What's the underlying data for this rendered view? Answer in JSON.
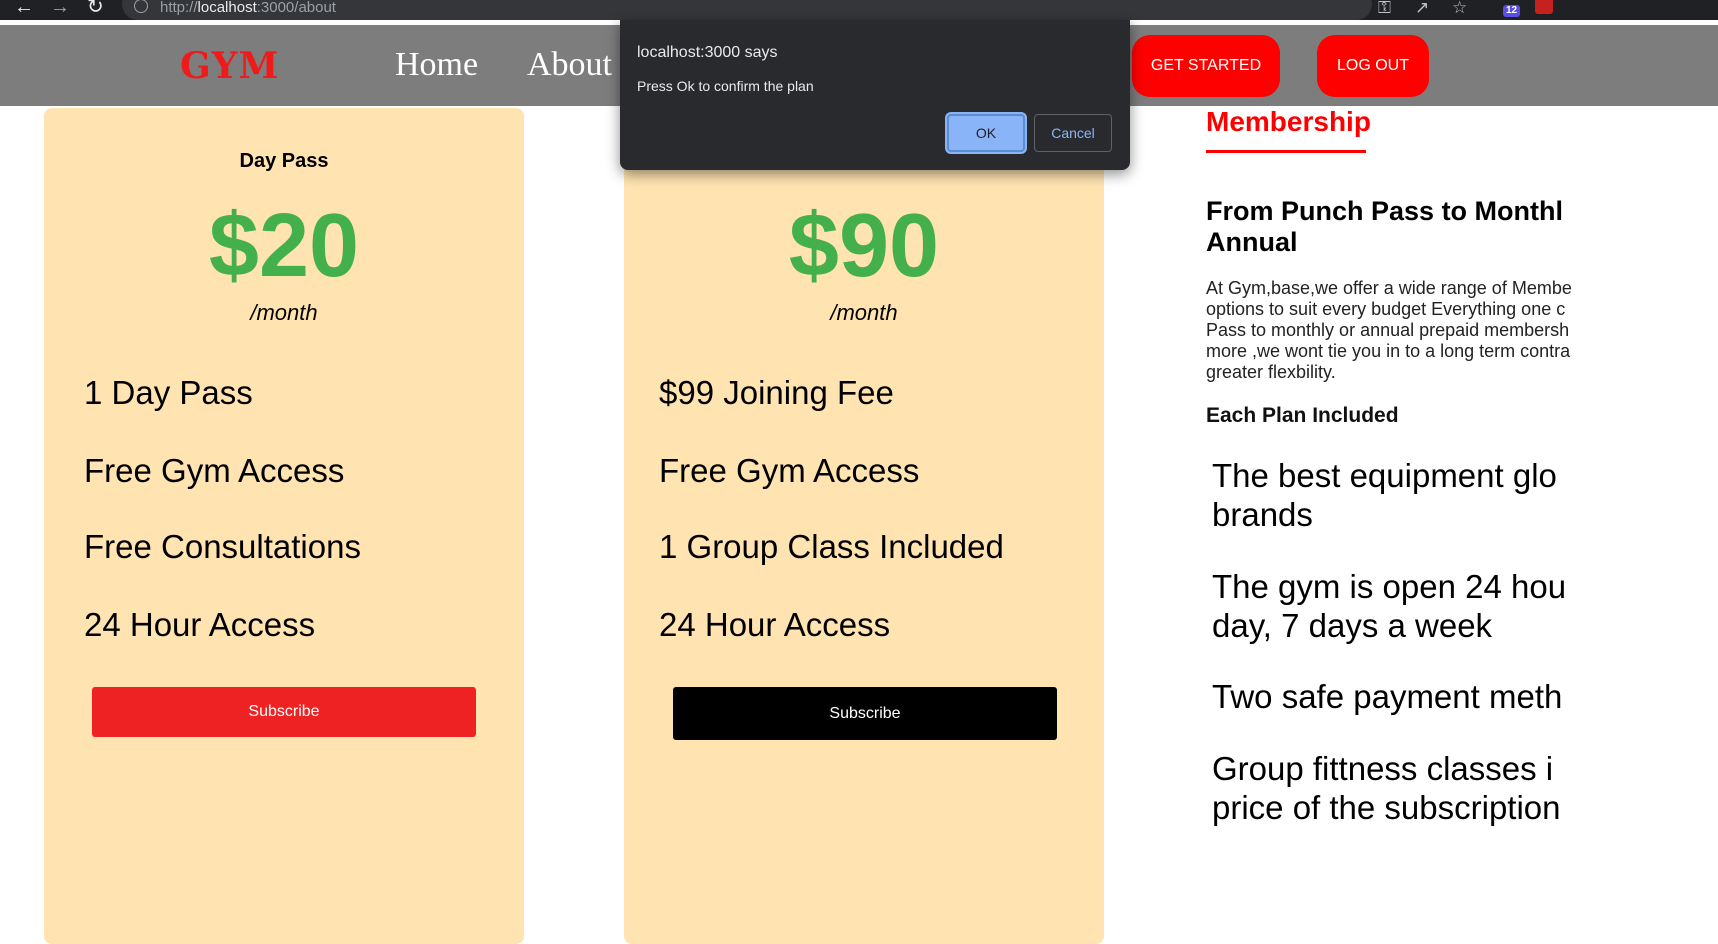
{
  "browser": {
    "url_scheme": "http://",
    "url_host": "localhost",
    "url_path": ":3000/about",
    "extension_badge": "12"
  },
  "navbar": {
    "logo": "GYM",
    "links": [
      "Home",
      "About"
    ],
    "get_started": "GET STARTED",
    "log_out": "LOG OUT"
  },
  "plans": [
    {
      "name": "Day Pass",
      "price": "$20",
      "period": "/month",
      "features": [
        "1 Day Pass",
        "Free Gym Access",
        "Free Consultations",
        "24 Hour Access"
      ],
      "button": "Subscribe",
      "button_color": "#ee2222"
    },
    {
      "name": "",
      "price": "$90",
      "period": "/month",
      "features": [
        "$99 Joining Fee",
        "Free Gym Access",
        "1 Group Class Included",
        "24 Hour Access"
      ],
      "button": "Subscribe",
      "button_color": "#000000"
    }
  ],
  "membership": {
    "title": "Membership",
    "heading_lines": [
      "From Punch Pass to Monthl",
      "Annual"
    ],
    "paragraph_lines": [
      "At Gym,base,we offer a wide range of Membe",
      "options to suit every budget Everything one c",
      "Pass to monthly or annual prepaid membersh",
      "more ,we wont tie you in to a long term contra",
      "greater flexbility."
    ],
    "subheading": "Each Plan Included",
    "items": [
      [
        "The best equipment glo",
        "brands"
      ],
      [
        "The gym is open 24 hou",
        "day, 7 days a week"
      ],
      [
        "Two safe payment meth"
      ],
      [
        "Group fittness classes i",
        "price of the subscription"
      ]
    ]
  },
  "dialog": {
    "title": "localhost:3000 says",
    "message": "Press Ok to confirm the plan",
    "ok": "OK",
    "cancel": "Cancel"
  }
}
